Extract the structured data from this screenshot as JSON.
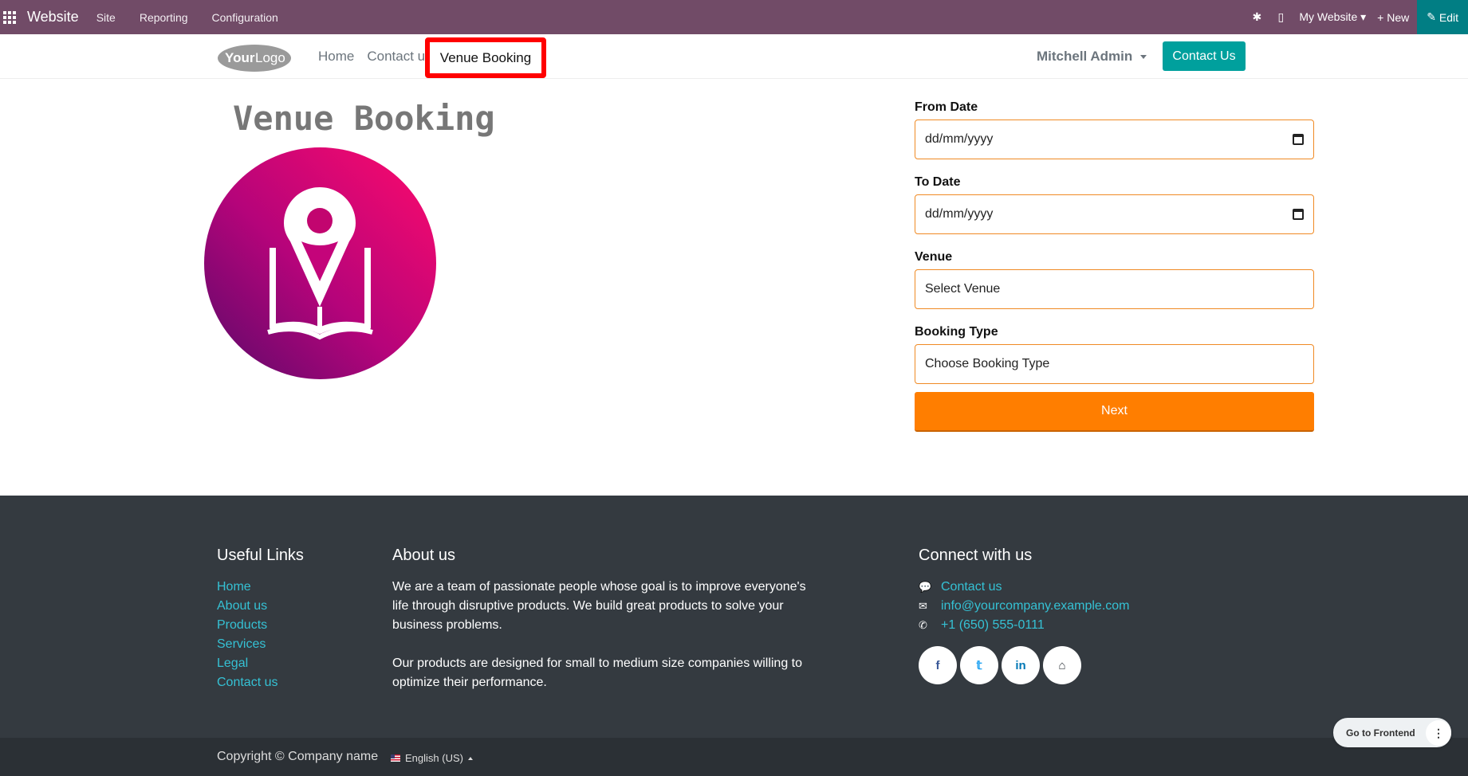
{
  "admin_bar": {
    "app_name": "Website",
    "menu": [
      "Site",
      "Reporting",
      "Configuration"
    ],
    "website_selector": "My Website",
    "new_label": "New",
    "edit_label": "Edit"
  },
  "header": {
    "logo_alt": "YourLogo",
    "nav": [
      "Home",
      "Contact us"
    ],
    "active_nav": "Venue Booking",
    "user": "Mitchell Admin",
    "contact_button": "Contact Us"
  },
  "main": {
    "title": "Venue Booking",
    "form": {
      "from_date_label": "From Date",
      "from_date_placeholder": "dd/mm/yyyy",
      "to_date_label": "To Date",
      "to_date_placeholder": "dd/mm/yyyy",
      "venue_label": "Venue",
      "venue_value": "Select Venue",
      "booking_type_label": "Booking Type",
      "booking_type_value": "Choose Booking Type",
      "next_label": "Next"
    }
  },
  "footer": {
    "useful_links_title": "Useful Links",
    "useful_links": [
      "Home",
      "About us",
      "Products",
      "Services",
      "Legal",
      "Contact us"
    ],
    "about_title": "About us",
    "about_p1": "We are a team of passionate people whose goal is to improve everyone's life through disruptive products. We build great products to solve your business problems.",
    "about_p2": "Our products are designed for small to medium size companies willing to optimize their performance.",
    "connect_title": "Connect with us",
    "connect_contact": "Contact us",
    "connect_email": "info@yourcompany.example.com",
    "connect_phone": "+1 (650) 555-0111",
    "socials": [
      "facebook-icon",
      "twitter-icon",
      "linkedin-icon",
      "home-icon"
    ]
  },
  "copyright": {
    "text": "Copyright © Company name",
    "language": "English (US)"
  },
  "floating": {
    "go_frontend": "Go to Frontend"
  },
  "colors": {
    "admin_bar": "#714b67",
    "accent": "#00a09d",
    "next_button": "#ff7e00",
    "footer": "#343a40",
    "footer_links": "#35c1d4"
  }
}
